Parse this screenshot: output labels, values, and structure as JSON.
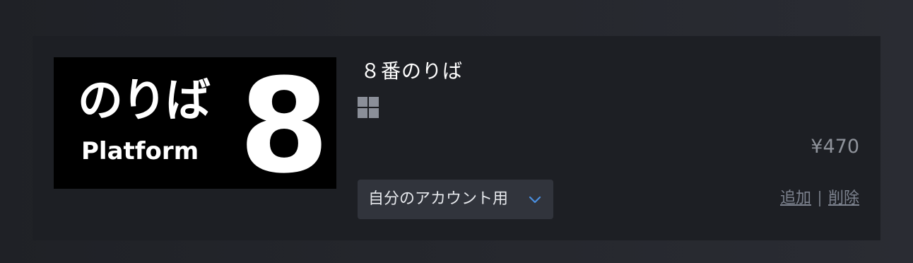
{
  "item": {
    "capsule": {
      "jp_text": "のりば",
      "en_text": "Platform",
      "number": "8"
    },
    "title": "８番のりば",
    "platform_icon": "windows-icon",
    "price": "¥470",
    "account_select": {
      "label": "自分のアカウント用",
      "icon": "chevron-down-icon"
    },
    "actions": {
      "add": "追加",
      "remove": "削除"
    }
  },
  "colors": {
    "background": "#23252b",
    "card": "#1d1f24",
    "select_bg": "#31343c",
    "chevron": "#4a8fe0",
    "link": "#7d838f",
    "price": "#8f939b"
  }
}
